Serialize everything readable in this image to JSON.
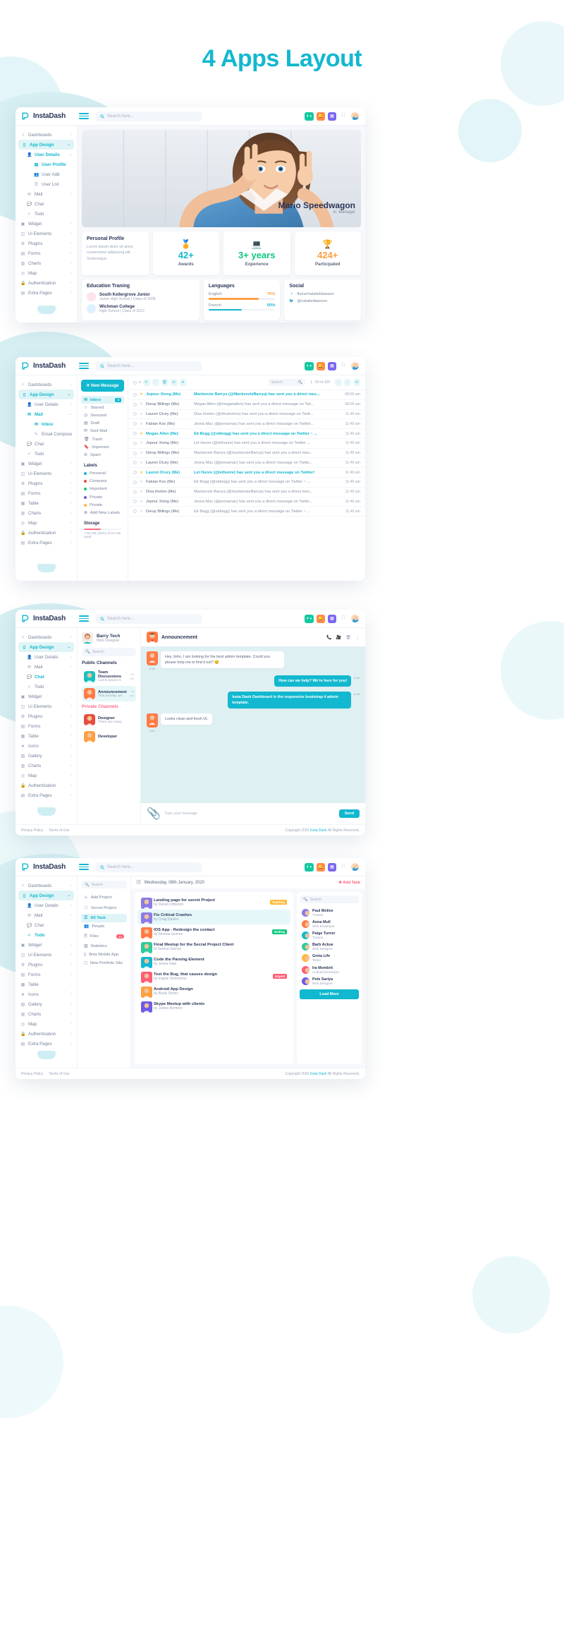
{
  "page": {
    "title": "4 Apps Layout",
    "accent": "#12b8cf"
  },
  "brand": {
    "name": "InstaDash"
  },
  "search": {
    "placeholder": "Search here...",
    "icon": "search-icon"
  },
  "topbar": {
    "pill_label": "4",
    "icons": [
      "grid-icon",
      "bell-icon",
      "apps-icon",
      "fullscreen-icon",
      "user-avatar"
    ]
  },
  "sidebar1": {
    "items": [
      {
        "label": "Dashboards",
        "icon": "home-icon",
        "caret": "›",
        "level": 0
      },
      {
        "label": "App Design",
        "icon": "mobile-icon",
        "caret": "⌄",
        "level": 0,
        "active": true
      },
      {
        "label": "User Details",
        "icon": "user-icon",
        "caret": "⌄",
        "level": 1,
        "current": true
      },
      {
        "label": "User Profile",
        "icon": "profile-icon",
        "level": 2,
        "current": true
      },
      {
        "label": "User Add",
        "icon": "user-add-icon",
        "level": 2
      },
      {
        "label": "User List",
        "icon": "list-icon",
        "level": 2
      },
      {
        "label": "Mail",
        "icon": "mail-icon",
        "caret": "›",
        "level": 1
      },
      {
        "label": "Chat",
        "icon": "chat-icon",
        "level": 1
      },
      {
        "label": "Todo",
        "icon": "check-icon",
        "level": 1
      },
      {
        "label": "Widget",
        "icon": "widget-icon",
        "caret": "›",
        "level": 0
      },
      {
        "label": "Ui Elements",
        "icon": "ui-icon",
        "caret": "›",
        "level": 0
      },
      {
        "label": "Plugins",
        "icon": "plugin-icon",
        "caret": "›",
        "level": 0
      },
      {
        "label": "Forms",
        "icon": "form-icon",
        "caret": "›",
        "level": 0
      },
      {
        "label": "Charts",
        "icon": "chart-icon",
        "caret": "›",
        "level": 0
      },
      {
        "label": "Map",
        "icon": "map-icon",
        "caret": "›",
        "level": 0
      },
      {
        "label": "Authentication",
        "icon": "lock-icon",
        "caret": "›",
        "level": 0
      },
      {
        "label": "Extra Pages",
        "icon": "pages-icon",
        "caret": "›",
        "level": 0
      }
    ]
  },
  "profile": {
    "name": "Mario Speedwagon",
    "role": "sr. Manager",
    "personal": {
      "title": "Personal Profile",
      "text": "Lorem ipsum dolor sit amet, consectetur adipiscing elit. Scelerisque."
    },
    "stats": [
      {
        "value": "42+",
        "caption": "Awards",
        "color": "#12b8cf",
        "icon": "award-icon"
      },
      {
        "value": "3+ years",
        "caption": "Experience",
        "color": "#0ec97f",
        "icon": "code-icon"
      },
      {
        "value": "424+",
        "caption": "Participated",
        "color": "#ff9f43",
        "icon": "trophy-icon"
      }
    ],
    "education": {
      "title": "Education Traning",
      "items": [
        {
          "school": "South Kellergrove Junior",
          "detail": "Junior High School | Class of 2008"
        },
        {
          "school": "Wichman College",
          "detail": "High School | Class of 2012"
        }
      ]
    },
    "languages": {
      "title": "Languages",
      "items": [
        {
          "name": "English",
          "percent": "75%",
          "value": 75,
          "color": "#ff9f43"
        },
        {
          "name": "French",
          "percent": "50%",
          "value": 50,
          "color": "#12b8cf"
        }
      ]
    },
    "social": {
      "title": "Social",
      "items": [
        {
          "icon": "facebook-icon",
          "handle": "flume/natalieldawson"
        },
        {
          "icon": "twitter-icon",
          "handle": "@natalieldawson"
        }
      ]
    }
  },
  "sidebar2": {
    "items": [
      {
        "label": "Dashboards",
        "icon": "home-icon",
        "caret": "›",
        "level": 0
      },
      {
        "label": "App Design",
        "icon": "mobile-icon",
        "caret": "⌄",
        "level": 0,
        "active": true
      },
      {
        "label": "User Details",
        "icon": "user-icon",
        "caret": "›",
        "level": 1
      },
      {
        "label": "Mail",
        "icon": "mail-icon",
        "caret": "⌄",
        "level": 1,
        "current": true
      },
      {
        "label": "Inbox",
        "icon": "inbox-icon",
        "level": 2,
        "current": true
      },
      {
        "label": "Email Compose",
        "icon": "compose-icon",
        "level": 2
      },
      {
        "label": "Chat",
        "icon": "chat-icon",
        "level": 1
      },
      {
        "label": "Todo",
        "icon": "check-icon",
        "level": 1
      },
      {
        "label": "Widget",
        "icon": "widget-icon",
        "caret": "›",
        "level": 0
      },
      {
        "label": "Ui Elements",
        "icon": "ui-icon",
        "caret": "›",
        "level": 0
      },
      {
        "label": "Plugins",
        "icon": "plugin-icon",
        "caret": "›",
        "level": 0
      },
      {
        "label": "Forms",
        "icon": "form-icon",
        "caret": "›",
        "level": 0
      },
      {
        "label": "Table",
        "icon": "table-icon",
        "caret": "›",
        "level": 0
      },
      {
        "label": "Charts",
        "icon": "chart-icon",
        "caret": "›",
        "level": 0
      },
      {
        "label": "Map",
        "icon": "map-icon",
        "caret": "›",
        "level": 0
      },
      {
        "label": "Authentication",
        "icon": "lock-icon",
        "caret": "›",
        "level": 0
      },
      {
        "label": "Extra Pages",
        "icon": "pages-icon",
        "caret": "›",
        "level": 0
      }
    ]
  },
  "mail": {
    "compose_label": "New Message",
    "folders": [
      {
        "label": "Inbox",
        "icon": "inbox-icon",
        "badge": "4",
        "active": true
      },
      {
        "label": "Starred",
        "icon": "star-icon"
      },
      {
        "label": "Snoozed",
        "icon": "clock-icon"
      },
      {
        "label": "Draft",
        "icon": "draft-icon"
      },
      {
        "label": "Sent Mail",
        "icon": "sent-icon"
      },
      {
        "label": "Trash",
        "icon": "trash-icon"
      },
      {
        "label": "Important",
        "icon": "bookmark-icon"
      },
      {
        "label": "Spam",
        "icon": "spam-icon"
      }
    ],
    "labels_title": "Labels",
    "labels": [
      {
        "label": "Personal",
        "color": "#12b8cf"
      },
      {
        "label": "Company",
        "color": "#f4443c"
      },
      {
        "label": "Important",
        "color": "#0ec97f"
      },
      {
        "label": "Private",
        "color": "#6c5ce7"
      },
      {
        "label": "Private",
        "color": "#ffb93c"
      }
    ],
    "add_labels": "Add New Labels",
    "storage_title": "Storage",
    "storage_text": "7.02 GB (46%) of 15 GB used",
    "toolbar": {
      "search_placeholder": "Search",
      "pager": "1 - 50 of 105"
    },
    "rows": [
      {
        "from": "Jopour Xiong (Me)",
        "subject": "Mackenzie Barryo (@MackenzieBarrya) has sent you a direct mes...",
        "time": "08:00 am",
        "unread": true,
        "starred": true
      },
      {
        "from": "Deray Billings (Me)",
        "subject": "Megan Allen (@meganallen) has sent you a direct message on Twi...",
        "time": "08:05 am"
      },
      {
        "from": "Lauren Drury (Me)",
        "subject": "Dixa Horton (@dixahorton) has sent you a direct message on Twitt...",
        "time": "11:49 am"
      },
      {
        "from": "Fabian Kos (Me)",
        "subject": "Jeona Mac (@jeonamac) has sent you a direct message on Twitter...",
        "time": "11:49 am"
      },
      {
        "from": "Megan Allen (Me)",
        "subject": "Eb Begg (@ebbegg) has sent you a direct message on Twitter  ~ ...",
        "time": "11:49 am",
        "unread": true,
        "starred": true
      },
      {
        "from": "Jopour Xiong (Me)",
        "subject": "Let Hunre (@lethunre) has sent you a direct message on Twitter ...",
        "time": "11:49 am"
      },
      {
        "from": "Deray Billings (Me)",
        "subject": "Mackenzie Barrya (@mackenzieBarrya) has sent you a direct mes...",
        "time": "11:49 am"
      },
      {
        "from": "Lauren Drury (Me)",
        "subject": "Jeona Mac (@jeonamac) has sent you a direct message on Twitte...",
        "time": "11:49 am"
      },
      {
        "from": "Lauren Drury (Me)",
        "subject": "Let Hunre (@lethunre) has sent you a direct message on Twitter!",
        "time": "11:49 am",
        "unread": true,
        "starred": true
      },
      {
        "from": "Fabian Kos (Me)",
        "subject": "Eb Begg (@ebbegg) has sent you a direct message on Twitter  ~ ...",
        "time": "11:49 am"
      },
      {
        "from": "Dixa Horton (Me)",
        "subject": "Mackenzie Barrya (@mackenzieBarrya) has sent you a direct mes...",
        "time": "11:49 am"
      },
      {
        "from": "Jopour Xiong (Me)",
        "subject": "Jeona Mac (@jeonamac) has sent you a direct message on Twitte...",
        "time": "11:49 am"
      },
      {
        "from": "Deray Billings (Me)",
        "subject": "Eb Begg (@ebbegg) has sent you a direct message on Twitter  ~ ...",
        "time": "11:49 am"
      }
    ]
  },
  "sidebar3": {
    "items": [
      {
        "label": "Dashboards",
        "icon": "home-icon",
        "caret": "›",
        "level": 0
      },
      {
        "label": "App Design",
        "icon": "mobile-icon",
        "caret": "⌄",
        "level": 0,
        "active": true
      },
      {
        "label": "User Details",
        "icon": "user-icon",
        "caret": "›",
        "level": 1
      },
      {
        "label": "Mail",
        "icon": "mail-icon",
        "caret": "›",
        "level": 1
      },
      {
        "label": "Chat",
        "icon": "chat-icon",
        "level": 1,
        "current": true
      },
      {
        "label": "Todo",
        "icon": "check-icon",
        "level": 1
      },
      {
        "label": "Widget",
        "icon": "widget-icon",
        "caret": "›",
        "level": 0
      },
      {
        "label": "Ui Elements",
        "icon": "ui-icon",
        "caret": "›",
        "level": 0
      },
      {
        "label": "Plugins",
        "icon": "plugin-icon",
        "caret": "›",
        "level": 0
      },
      {
        "label": "Forms",
        "icon": "form-icon",
        "caret": "›",
        "level": 0
      },
      {
        "label": "Table",
        "icon": "table-icon",
        "caret": "›",
        "level": 0
      },
      {
        "label": "Icons",
        "icon": "icons-icon",
        "caret": "›",
        "level": 0
      },
      {
        "label": "Gallery",
        "icon": "gallery-icon",
        "caret": "›",
        "level": 0
      },
      {
        "label": "Charts",
        "icon": "chart-icon",
        "caret": "›",
        "level": 0
      },
      {
        "label": "Map",
        "icon": "map-icon",
        "caret": "›",
        "level": 0
      },
      {
        "label": "Authentication",
        "icon": "lock-icon",
        "caret": "›",
        "level": 0
      },
      {
        "label": "Extra Pages",
        "icon": "pages-icon",
        "caret": "›",
        "level": 0
      }
    ]
  },
  "chat": {
    "user": {
      "name": "Barry Tech",
      "role": "Web Designer"
    },
    "search_placeholder": "Search",
    "public_title": "Public Channels",
    "private_title": "Private Channels",
    "public_channels": [
      {
        "title": "Team Discussions",
        "preview": "Lorem Ipsum is",
        "time": "35 min"
      },
      {
        "title": "Announcement",
        "preview": "This Sunday we",
        "time": "16 min",
        "selected": true
      }
    ],
    "private_channels": [
      {
        "title": "Designer",
        "preview": "There are many",
        "time": ""
      },
      {
        "title": "Developer",
        "preview": "",
        "time": ""
      }
    ],
    "header": {
      "title": "Announcement",
      "icons": [
        "phone-icon",
        "video-icon",
        "trash-icon",
        "more-icon"
      ]
    },
    "messages": [
      {
        "side": "them",
        "text": "Hey John, I am looking for the best admin template. Could you please help me to find it out? 😊",
        "time": "6:48"
      },
      {
        "side": "me",
        "text": "How can we help? We're here for you!",
        "time": "6:45"
      },
      {
        "side": "me",
        "text": "Insta Dash Dashboard is the responsive bootstrap 4 admin template.",
        "time": "6:48"
      },
      {
        "side": "them",
        "text": "Looks clean and fresh UI.",
        "time": "6:52"
      }
    ],
    "input_placeholder": "Type your message",
    "send_label": "Send"
  },
  "sidebar4": {
    "items": [
      {
        "label": "Dashboards",
        "icon": "home-icon",
        "caret": "›",
        "level": 0
      },
      {
        "label": "App Design",
        "icon": "mobile-icon",
        "caret": "⌄",
        "level": 0,
        "active": true
      },
      {
        "label": "User Details",
        "icon": "user-icon",
        "caret": "›",
        "level": 1
      },
      {
        "label": "Mail",
        "icon": "mail-icon",
        "caret": "›",
        "level": 1
      },
      {
        "label": "Chat",
        "icon": "chat-icon",
        "level": 1
      },
      {
        "label": "Todo",
        "icon": "check-icon",
        "level": 1,
        "current": true
      },
      {
        "label": "Widget",
        "icon": "widget-icon",
        "caret": "›",
        "level": 0
      },
      {
        "label": "Ui Elements",
        "icon": "ui-icon",
        "caret": "›",
        "level": 0
      },
      {
        "label": "Plugins",
        "icon": "plugin-icon",
        "caret": "›",
        "level": 0
      },
      {
        "label": "Forms",
        "icon": "form-icon",
        "caret": "›",
        "level": 0
      },
      {
        "label": "Table",
        "icon": "table-icon",
        "caret": "›",
        "level": 0
      },
      {
        "label": "Icons",
        "icon": "icons-icon",
        "caret": "›",
        "level": 0
      },
      {
        "label": "Gallery",
        "icon": "gallery-icon",
        "caret": "›",
        "level": 0
      },
      {
        "label": "Charts",
        "icon": "chart-icon",
        "caret": "›",
        "level": 0
      },
      {
        "label": "Map",
        "icon": "map-icon",
        "caret": "›",
        "level": 0
      },
      {
        "label": "Authentication",
        "icon": "lock-icon",
        "caret": "›",
        "level": 0
      },
      {
        "label": "Extra Pages",
        "icon": "pages-icon",
        "caret": "›",
        "level": 0
      }
    ]
  },
  "todo": {
    "search_placeholder": "Search",
    "nav": [
      {
        "label": "Add Project",
        "icon": "plus-icon"
      },
      {
        "label": "Secret Project",
        "icon": "folder-icon"
      },
      {
        "label": "All Task",
        "icon": "list-icon",
        "active": true
      },
      {
        "label": "People",
        "icon": "people-icon"
      },
      {
        "label": "Files",
        "icon": "file-icon",
        "badge": "44"
      },
      {
        "label": "Statistics",
        "icon": "stats-icon"
      },
      {
        "label": "Bnla Mobile App",
        "icon": "app-icon"
      },
      {
        "label": "New Portfolio Site",
        "icon": "site-icon"
      }
    ],
    "date_label": "Wednesday, 08th January, 2020",
    "add_task_label": "Add Task",
    "tasks": [
      {
        "title": "Landing page for secret Project",
        "by": "by Daniel Clifterton",
        "tag": "Expiring",
        "tag_color": "#ffb93c",
        "avatar": "#8c7ae6"
      },
      {
        "title": "Fix Critical Crashes",
        "by": "by Craig Danles",
        "tag": "",
        "tag_color": "",
        "avatar": "#8c7ae6",
        "selected": true
      },
      {
        "title": "IOS App - Redesign the contact",
        "by": "by Simona Gomez",
        "tag": "Ending",
        "tag_color": "#0ec97f",
        "avatar": "#ff7a45"
      },
      {
        "title": "Final Meetup for the Secrat Project Client",
        "by": "bt Serena Gemoz",
        "tag": "",
        "tag_color": "",
        "avatar": "#2ecc9b"
      },
      {
        "title": "Code the Parsing Element",
        "by": "by Jeana Gale",
        "tag": "",
        "tag_color": "",
        "avatar": "#12b8cf"
      },
      {
        "title": "Test the Bug, that causes design",
        "by": "by miguie Simmonos",
        "tag": "Urgent",
        "tag_color": "#ff5c75",
        "avatar": "#ff5c75"
      },
      {
        "title": "Android App Design",
        "by": "by Beely Dimes",
        "tag": "",
        "tag_color": "",
        "avatar": "#ff9f43"
      },
      {
        "title": "Skype Meetup with clients",
        "by": "by James Romero",
        "tag": "",
        "tag_color": "",
        "avatar": "#6c5ce7"
      }
    ],
    "members_search_placeholder": "Search",
    "members": [
      {
        "name": "Paul Molive",
        "role": "Trainee",
        "color": "#8c7ae6"
      },
      {
        "name": "Anna Mull",
        "role": "Web Developer",
        "color": "#ff7a45"
      },
      {
        "name": "Paige Turner",
        "role": "Trainee",
        "color": "#12b8cf"
      },
      {
        "name": "Barb Ackue",
        "role": "Web Designer",
        "color": "#2ecc9b"
      },
      {
        "name": "Greta Life",
        "role": "Tester",
        "color": "#ffb93c"
      },
      {
        "name": "Ira Membrit",
        "role": "Android Developer",
        "color": "#ff5c75"
      },
      {
        "name": "Pete Sariya",
        "role": "Web Designer",
        "color": "#6c5ce7"
      }
    ],
    "load_more": "Load More"
  },
  "footer": {
    "privacy": "Privacy Policy",
    "terms": "Terms of Use",
    "copyright_pre": "Copyright 2020 ",
    "copyright_link": "Insta Dash",
    "copyright_post": " All Rights Reserved."
  }
}
